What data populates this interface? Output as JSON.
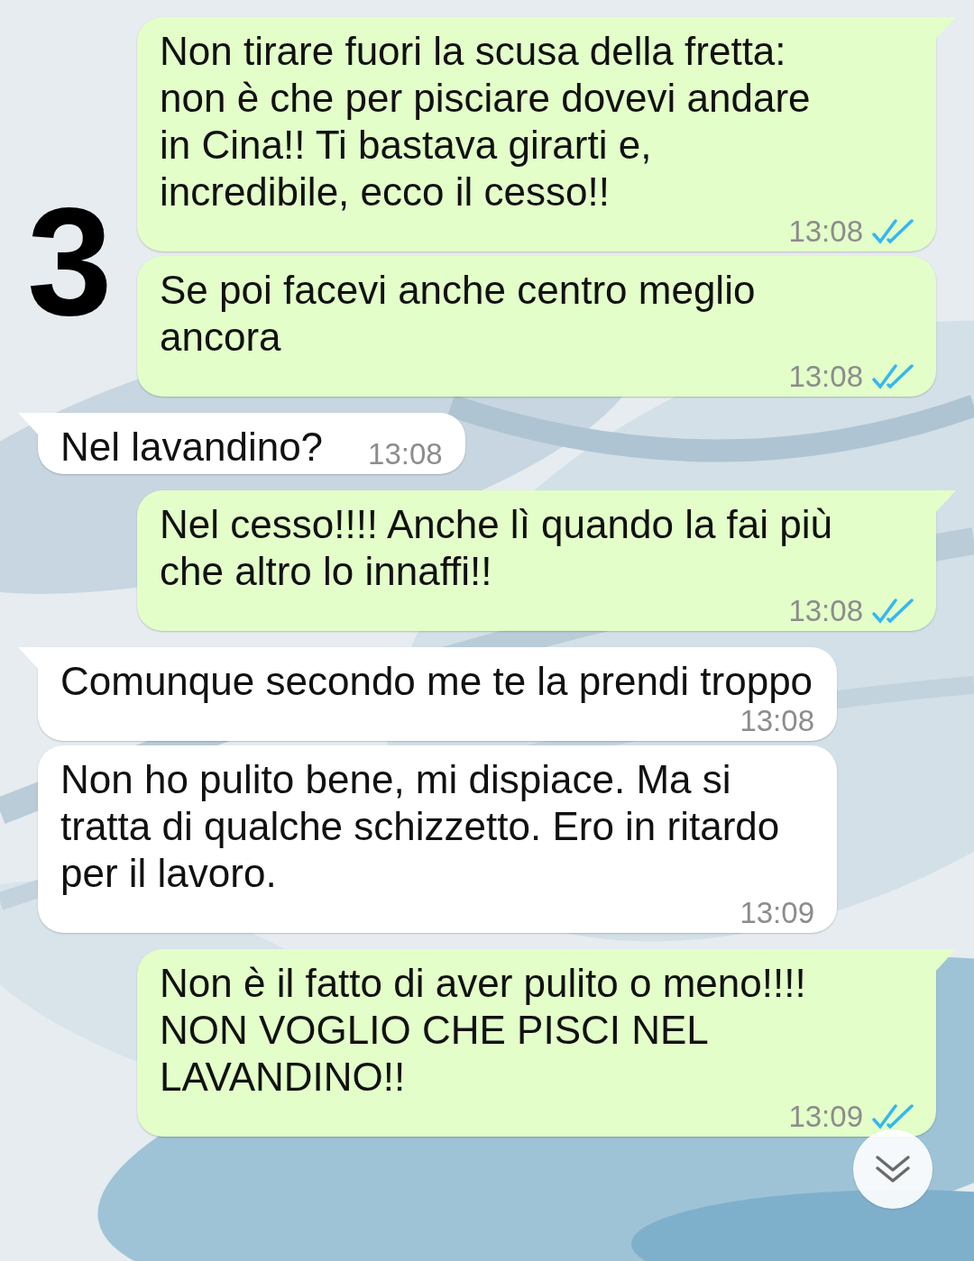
{
  "annotation": "3",
  "messages": [
    {
      "kind": "outgoing",
      "tail": true,
      "text": "Non tirare fuori la scusa della fretta: non è che per pisciare dovevi andare in Cina!! Ti bastava girarti e, incredibile, ecco il cesso!!",
      "time": "13:08",
      "read": true
    },
    {
      "kind": "outgoing",
      "tail": false,
      "text": "Se poi facevi anche centro meglio ancora",
      "time": "13:08",
      "read": true
    },
    {
      "kind": "incoming",
      "tail": true,
      "text": "Nel lavandino?",
      "time": "13:08"
    },
    {
      "kind": "outgoing",
      "tail": true,
      "text": "Nel cesso!!!! Anche lì quando la fai più che altro lo innaffi!!",
      "time": "13:08",
      "read": true
    },
    {
      "kind": "incoming",
      "tail": true,
      "text": "Comunque secondo me te la prendi troppo",
      "time": "13:08"
    },
    {
      "kind": "incoming",
      "tail": false,
      "text": "Non ho pulito bene, mi dispiace. Ma si tratta di qualche schizzetto. Ero in ritardo per il lavoro.",
      "time": "13:09"
    },
    {
      "kind": "outgoing",
      "tail": true,
      "text": "Non è il fatto di aver pulito o meno!!!! NON VOGLIO CHE PISCI NEL LAVANDINO!!",
      "time": "13:09",
      "read": true
    }
  ]
}
